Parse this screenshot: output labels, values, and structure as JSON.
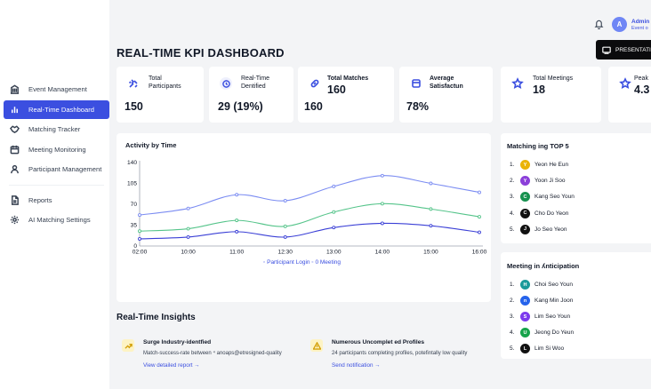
{
  "header": {
    "title": "REAL-TIME KPI DASHBOARD",
    "user_initial": "A",
    "user_name": "Admin",
    "user_subtitle": "Event o",
    "presentation_label": "PRESENTATI"
  },
  "sidebar": {
    "items": [
      {
        "label": "Event Management",
        "icon": "building-icon",
        "active": false
      },
      {
        "label": "Real-Time Dashboard",
        "icon": "bar-chart-icon",
        "active": true
      },
      {
        "label": "Matching Tracker",
        "icon": "handshake-icon",
        "active": false
      },
      {
        "label": "Meeting Monitoring",
        "icon": "calendar-icon",
        "active": false
      },
      {
        "label": "Participant Management",
        "icon": "user-icon",
        "active": false
      },
      {
        "label": "Reports",
        "icon": "document-icon",
        "active": false
      },
      {
        "label": "AI Matching Settings",
        "icon": "gear-icon",
        "active": false
      }
    ]
  },
  "kpis": [
    {
      "label_line1": "Total",
      "label_line2": "Participants",
      "value": "150",
      "icon": "participants-icon"
    },
    {
      "label_line1": "Real-Time",
      "label_line2": "Dentified",
      "value": "29 (19%)",
      "icon": "clock-icon"
    },
    {
      "label_line1": "Total Matches",
      "label_line2": "",
      "value": "160",
      "icon": "link-icon"
    },
    {
      "label_line1": "Average",
      "label_line2": "Satisfactun",
      "value": "78%",
      "icon": "box-icon"
    },
    {
      "label_line1": "Total Meetings",
      "label_line2": "",
      "value": "18",
      "icon": "star-icon"
    },
    {
      "label_line1": "Peak",
      "label_line2": "",
      "value": "4.3",
      "icon": "star-icon"
    }
  ],
  "activity": {
    "title": "Activity by Time",
    "legend": "◦ Participant Login ◦ 0 Meeting"
  },
  "chart_data": {
    "type": "line",
    "title": "Activity by Time",
    "x": [
      "02:00",
      "10:00",
      "11:00",
      "12:30",
      "13:00",
      "14:00",
      "15:00",
      "16:00"
    ],
    "x_ticks": [
      "02:00",
      "10:00",
      "11:00",
      "12:30",
      "13:00",
      "14:00",
      "15:00",
      "16:00"
    ],
    "y_ticks": [
      0,
      35,
      70,
      105,
      140
    ],
    "ylim": [
      0,
      140
    ],
    "series": [
      {
        "name": "Participant Login",
        "color": "#7b8cf2",
        "values": [
          52,
          63,
          86,
          76,
          100,
          118,
          105,
          90
        ]
      },
      {
        "name": "",
        "color": "#55c48a",
        "values": [
          25,
          29,
          43,
          33,
          57,
          71,
          62,
          49
        ]
      },
      {
        "name": "0 Meeting",
        "color": "#3a3fd6",
        "values": [
          12,
          15,
          24,
          15,
          31,
          38,
          34,
          23
        ]
      }
    ],
    "legend_text": "◦ Participant Login ◦ 0 Meeting"
  },
  "top5": {
    "title": "Matching ing TOP 5",
    "items": [
      {
        "rank": "1.",
        "initial": "Y",
        "name": "Yeon He Eun",
        "color": "#eab308"
      },
      {
        "rank": "2.",
        "initial": "Y",
        "name": "Yoon Ji Soo",
        "color": "#8b3fd9"
      },
      {
        "rank": "3.",
        "initial": "C",
        "name": "Kang Seo Youn",
        "color": "#17914f"
      },
      {
        "rank": "4.",
        "initial": "C",
        "name": "Cho Do Yeon",
        "color": "#111111"
      },
      {
        "rank": "5.",
        "initial": "J",
        "name": "Jo Seo Yeon",
        "color": "#111111"
      }
    ]
  },
  "anticipation": {
    "title": "Meeting in ʎnticipation",
    "items": [
      {
        "rank": "1.",
        "initial": "H",
        "name": "Choi Seo Youn",
        "color": "#1a9a9a"
      },
      {
        "rank": "2.",
        "initial": "n",
        "name": "Kang Min Joon",
        "color": "#2563eb"
      },
      {
        "rank": "3.",
        "initial": "S",
        "name": "Lim Seo Youn",
        "color": "#7c3aed"
      },
      {
        "rank": "4.",
        "initial": "U",
        "name": "Jeong Do Yeun",
        "color": "#16a34a"
      },
      {
        "rank": "5.",
        "initial": "L",
        "name": "Lim Si Woo",
        "color": "#111111"
      }
    ]
  },
  "insights": {
    "title": "Real-Time Insights",
    "items": [
      {
        "title": "Surge Industry-identfied",
        "body": "Match-success-rate between ⁴ anoaps@etresigned-quality",
        "link": "View detailed report →",
        "icon": "chart-up-icon"
      },
      {
        "title": "Numerous Uncomplet ed Profiles",
        "body": "24 participants completing profiles, potefintally low quality",
        "link": "Send notification →",
        "icon": "warning-icon"
      }
    ]
  }
}
